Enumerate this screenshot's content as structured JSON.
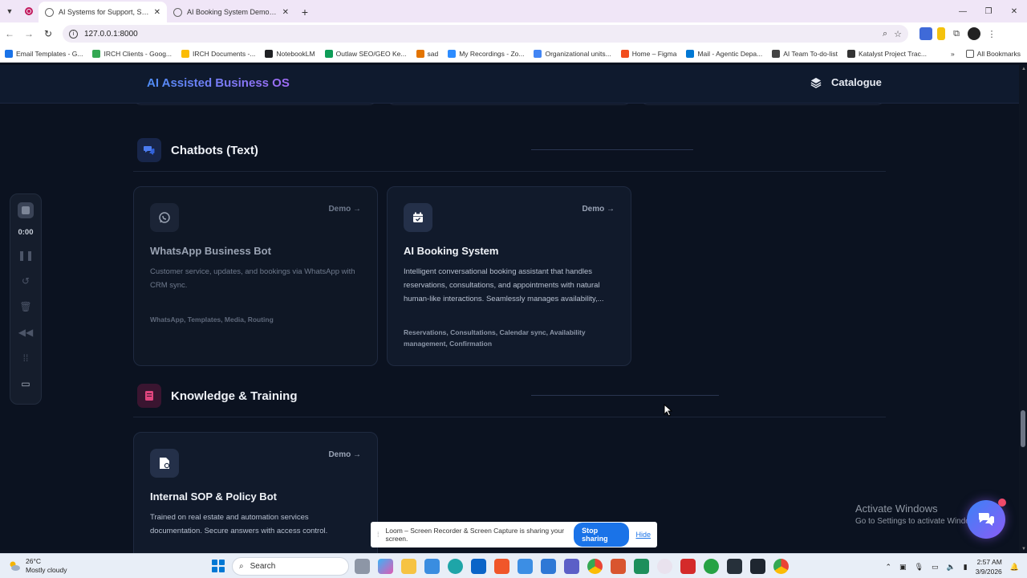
{
  "browser": {
    "tabs": [
      {
        "title": "AI Systems for Support, Sales, a",
        "active": true
      },
      {
        "title": "AI Booking System Demo - AI A",
        "active": false
      }
    ],
    "url": "127.0.0.1:8000",
    "bookmarks": [
      {
        "label": "Email Templates - G...",
        "color": "#1a73e8"
      },
      {
        "label": "IRCH Clients - Goog...",
        "color": "#34a853"
      },
      {
        "label": "IRCH Documents -...",
        "color": "#fbbc04"
      },
      {
        "label": "NotebookLM",
        "color": "#202124"
      },
      {
        "label": "Outlaw SEO/GEO Ke...",
        "color": "#0f9d58"
      },
      {
        "label": "sad",
        "color": "#e37400"
      },
      {
        "label": "My Recordings - Zo...",
        "color": "#2d8cff"
      },
      {
        "label": "Organizational units...",
        "color": "#4285f4"
      },
      {
        "label": "Home – Figma",
        "color": "#f24e1e"
      },
      {
        "label": "Mail - Agentic Depa...",
        "color": "#0078d4"
      },
      {
        "label": "AI Team To-do-list",
        "color": "#444444"
      },
      {
        "label": "Katalyst Project Trac...",
        "color": "#333333"
      }
    ],
    "all_bookmarks": "All Bookmarks"
  },
  "app": {
    "brand": "AI Assisted Business OS",
    "catalogue_label": "Catalogue"
  },
  "sections": [
    {
      "title": "Chatbots (Text)",
      "icon": "chat-bubbles-icon",
      "accent": "#3b6fe0",
      "cards": [
        {
          "title": "WhatsApp Business Bot",
          "icon": "whatsapp-icon",
          "demo": "Demo →",
          "description": "Customer service, updates, and bookings via WhatsApp with CRM sync.",
          "tags": "WhatsApp, Templates, Media, Routing",
          "dimmed": true
        },
        {
          "title": "AI Booking System",
          "icon": "calendar-icon",
          "demo": "Demo →",
          "description": "Intelligent conversational booking assistant that handles reservations, consultations, and appointments with natural human-like interactions. Seamlessly manages availability,...",
          "tags": "Reservations, Consultations, Calendar sync, Availability management, Confirmation",
          "dimmed": false
        }
      ]
    },
    {
      "title": "Knowledge & Training",
      "icon": "book-icon",
      "accent": "#d9467a",
      "cards": [
        {
          "title": "Internal SOP & Policy Bot",
          "icon": "document-icon",
          "demo": "Demo →",
          "description": "Trained on real estate and automation services documentation. Secure answers with access control.",
          "tags": "",
          "dimmed": false
        }
      ]
    }
  ],
  "recorder": {
    "time": "0:00"
  },
  "watermark": {
    "line1": "Activate Windows",
    "line2": "Go to Settings to activate Windows."
  },
  "loom_bar": {
    "message": "Loom – Screen Recorder & Screen Capture is sharing your screen.",
    "stop_label": "Stop sharing",
    "hide_label": "Hide"
  },
  "taskbar": {
    "temperature": "26°C",
    "weather": "Mostly cloudy",
    "search_placeholder": "Search",
    "time": "2:57 AM",
    "date": "3/9/2026"
  }
}
